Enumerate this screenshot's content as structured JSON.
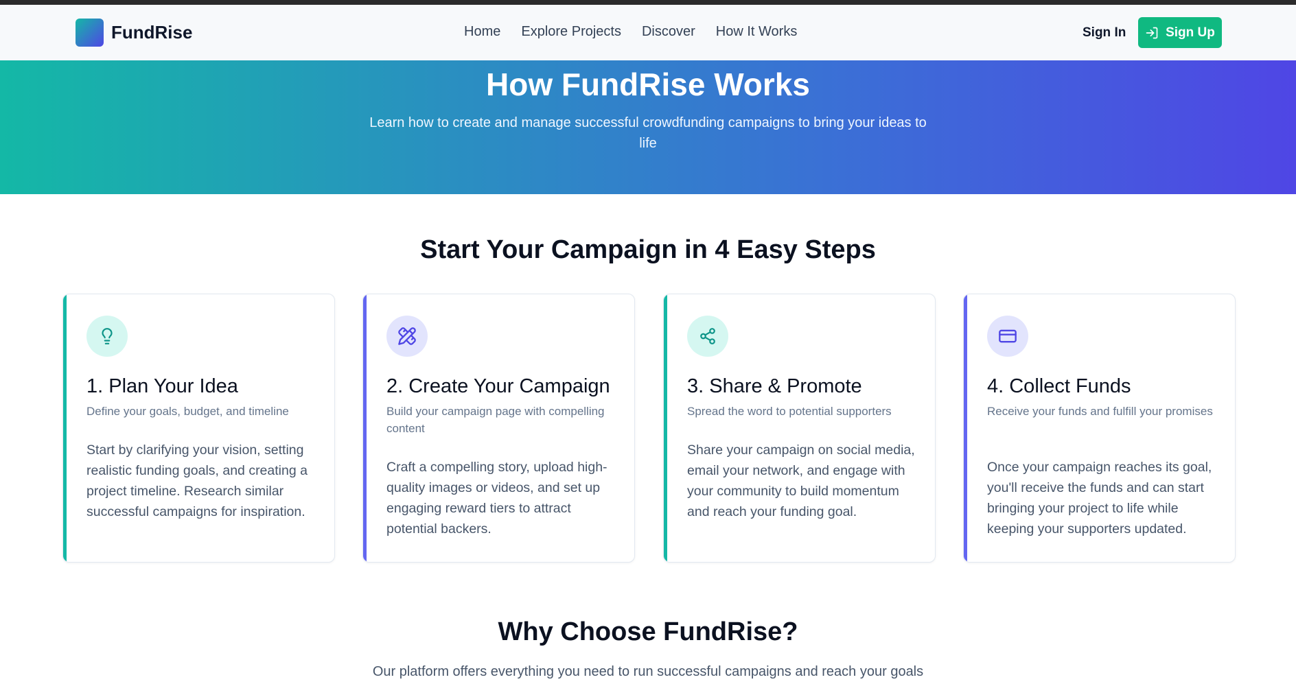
{
  "brand": {
    "name": "FundRise"
  },
  "nav": [
    "Home",
    "Explore Projects",
    "Discover",
    "How It Works"
  ],
  "auth": {
    "sign_in": "Sign In",
    "sign_up": "Sign Up"
  },
  "hero": {
    "title": "How FundRise Works",
    "subtitle": "Learn how to create and manage successful crowdfunding campaigns to bring your ideas to life"
  },
  "steps": {
    "title": "Start Your Campaign in 4 Easy Steps",
    "items": [
      {
        "title": "1. Plan Your Idea",
        "subtitle": "Define your goals, budget, and timeline",
        "body": "Start by clarifying your vision, setting realistic funding goals, and creating a project timeline. Research similar successful campaigns for inspiration.",
        "icon": "lightbulb-icon"
      },
      {
        "title": "2. Create Your Campaign",
        "subtitle": "Build your campaign page with compelling content",
        "body": "Craft a compelling story, upload high-quality images or videos, and set up engaging reward tiers to attract potential backers.",
        "icon": "pencil-ruler-icon"
      },
      {
        "title": "3. Share & Promote",
        "subtitle": "Spread the word to potential supporters",
        "body": "Share your campaign on social media, email your network, and engage with your community to build momentum and reach your funding goal.",
        "icon": "share-icon"
      },
      {
        "title": "4. Collect Funds",
        "subtitle": "Receive your funds and fulfill your promises",
        "body": "Once your campaign reaches its goal, you'll receive the funds and can start bringing your project to life while keeping your supporters updated.",
        "icon": "credit-card-icon"
      }
    ]
  },
  "why": {
    "title": "Why Choose FundRise?",
    "subtitle": "Our platform offers everything you need to run successful campaigns and reach your goals"
  },
  "colors": {
    "teal": "#14b8a6",
    "indigo": "#4f46e5",
    "signup_button": "#10b981"
  }
}
